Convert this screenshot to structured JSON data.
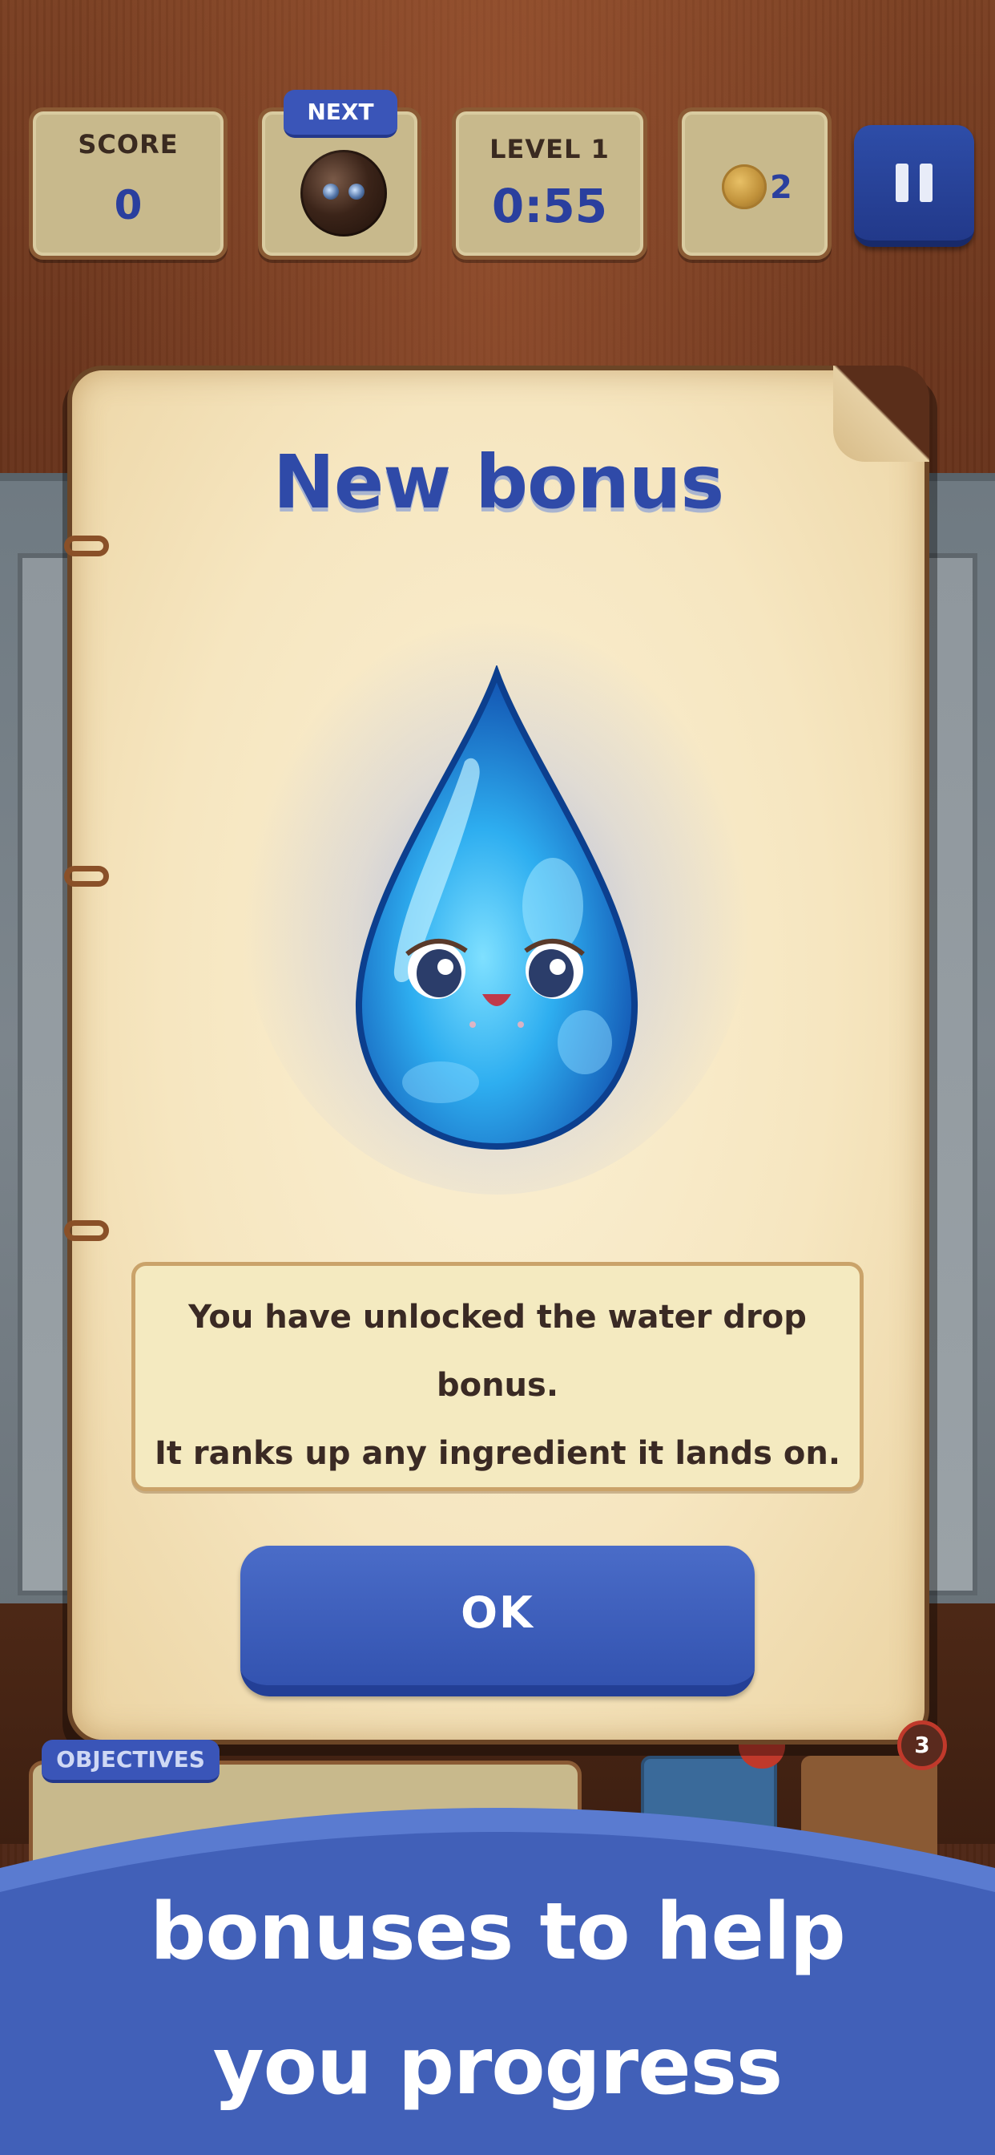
{
  "hud": {
    "score_label": "SCORE",
    "score_value": "0",
    "next_label": "NEXT",
    "level_label": "LEVEL 1",
    "timer_value": "0:55",
    "coins_value": "2"
  },
  "dialog": {
    "title": "New bonus",
    "line1": "You have unlocked the water drop",
    "line2": "bonus.",
    "line3": "It ranks up any ingredient it lands on.",
    "ok_label": "OK"
  },
  "objectives": {
    "tab_label": "OBJECTIVES",
    "badge_count": "3"
  },
  "banner": {
    "line1": "bonuses to help",
    "line2": "you progress"
  },
  "colors": {
    "accent_blue": "#3353b0",
    "title_blue": "#2f4aa8",
    "parchment": "#f6e6c0",
    "wood": "#5c2d18"
  },
  "icons": [
    "pause-icon",
    "coin-icon",
    "water-drop-icon",
    "next-ingredient-icon"
  ]
}
